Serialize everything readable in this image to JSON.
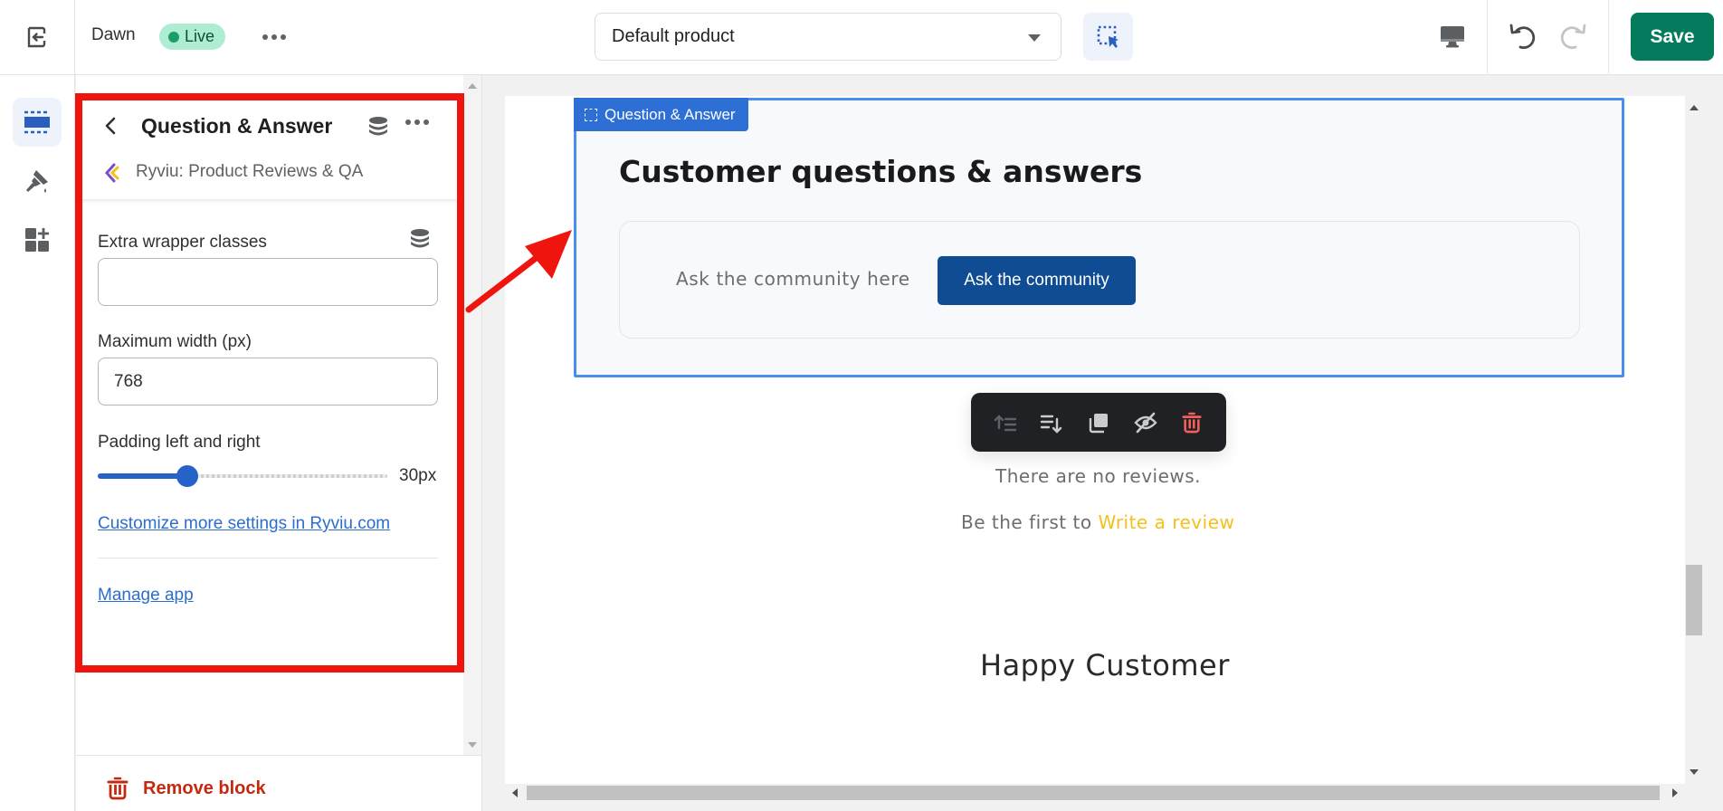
{
  "topbar": {
    "theme_name": "Dawn",
    "status_badge": "Live",
    "template_select": "Default product",
    "save_label": "Save"
  },
  "rail": {
    "items": [
      {
        "name": "sections",
        "icon": "sections-icon",
        "active": true
      },
      {
        "name": "theme-settings",
        "icon": "paintbrush-icon",
        "active": false
      },
      {
        "name": "app-embeds",
        "icon": "apps-add-icon",
        "active": false
      }
    ]
  },
  "panel": {
    "title": "Question & Answer",
    "app_name": "Ryviu: Product Reviews & QA",
    "fields": {
      "extra_wrapper_label": "Extra wrapper classes",
      "extra_wrapper_value": "",
      "max_width_label": "Maximum width (px)",
      "max_width_value": "768",
      "padding_label": "Padding left and right",
      "padding_value_text": "30px",
      "padding_fraction": 0.31
    },
    "customize_link": "Customize more settings in Ryviu.com",
    "manage_app_link": "Manage app",
    "remove_block_label": "Remove block"
  },
  "preview": {
    "block_tag": "Question & Answer",
    "heading": "Customer questions & answers",
    "ask_prompt": "Ask the community here",
    "ask_button": "Ask the community",
    "toolbar_actions": [
      "move-up",
      "move-down",
      "duplicate",
      "hide",
      "delete"
    ],
    "no_reviews": "There are no reviews.",
    "be_first_prefix": "Be the first to ",
    "write_review_link": "Write a review",
    "next_section_heading": "Happy Customer"
  },
  "colors": {
    "save": "#047b5d",
    "live_badge_bg": "#aeecd3",
    "selection_outline": "#4a8df0",
    "ask_button": "#0f4c94",
    "write_review": "#f3c11b",
    "annotation": "#f0140f",
    "remove": "#c4290f"
  }
}
